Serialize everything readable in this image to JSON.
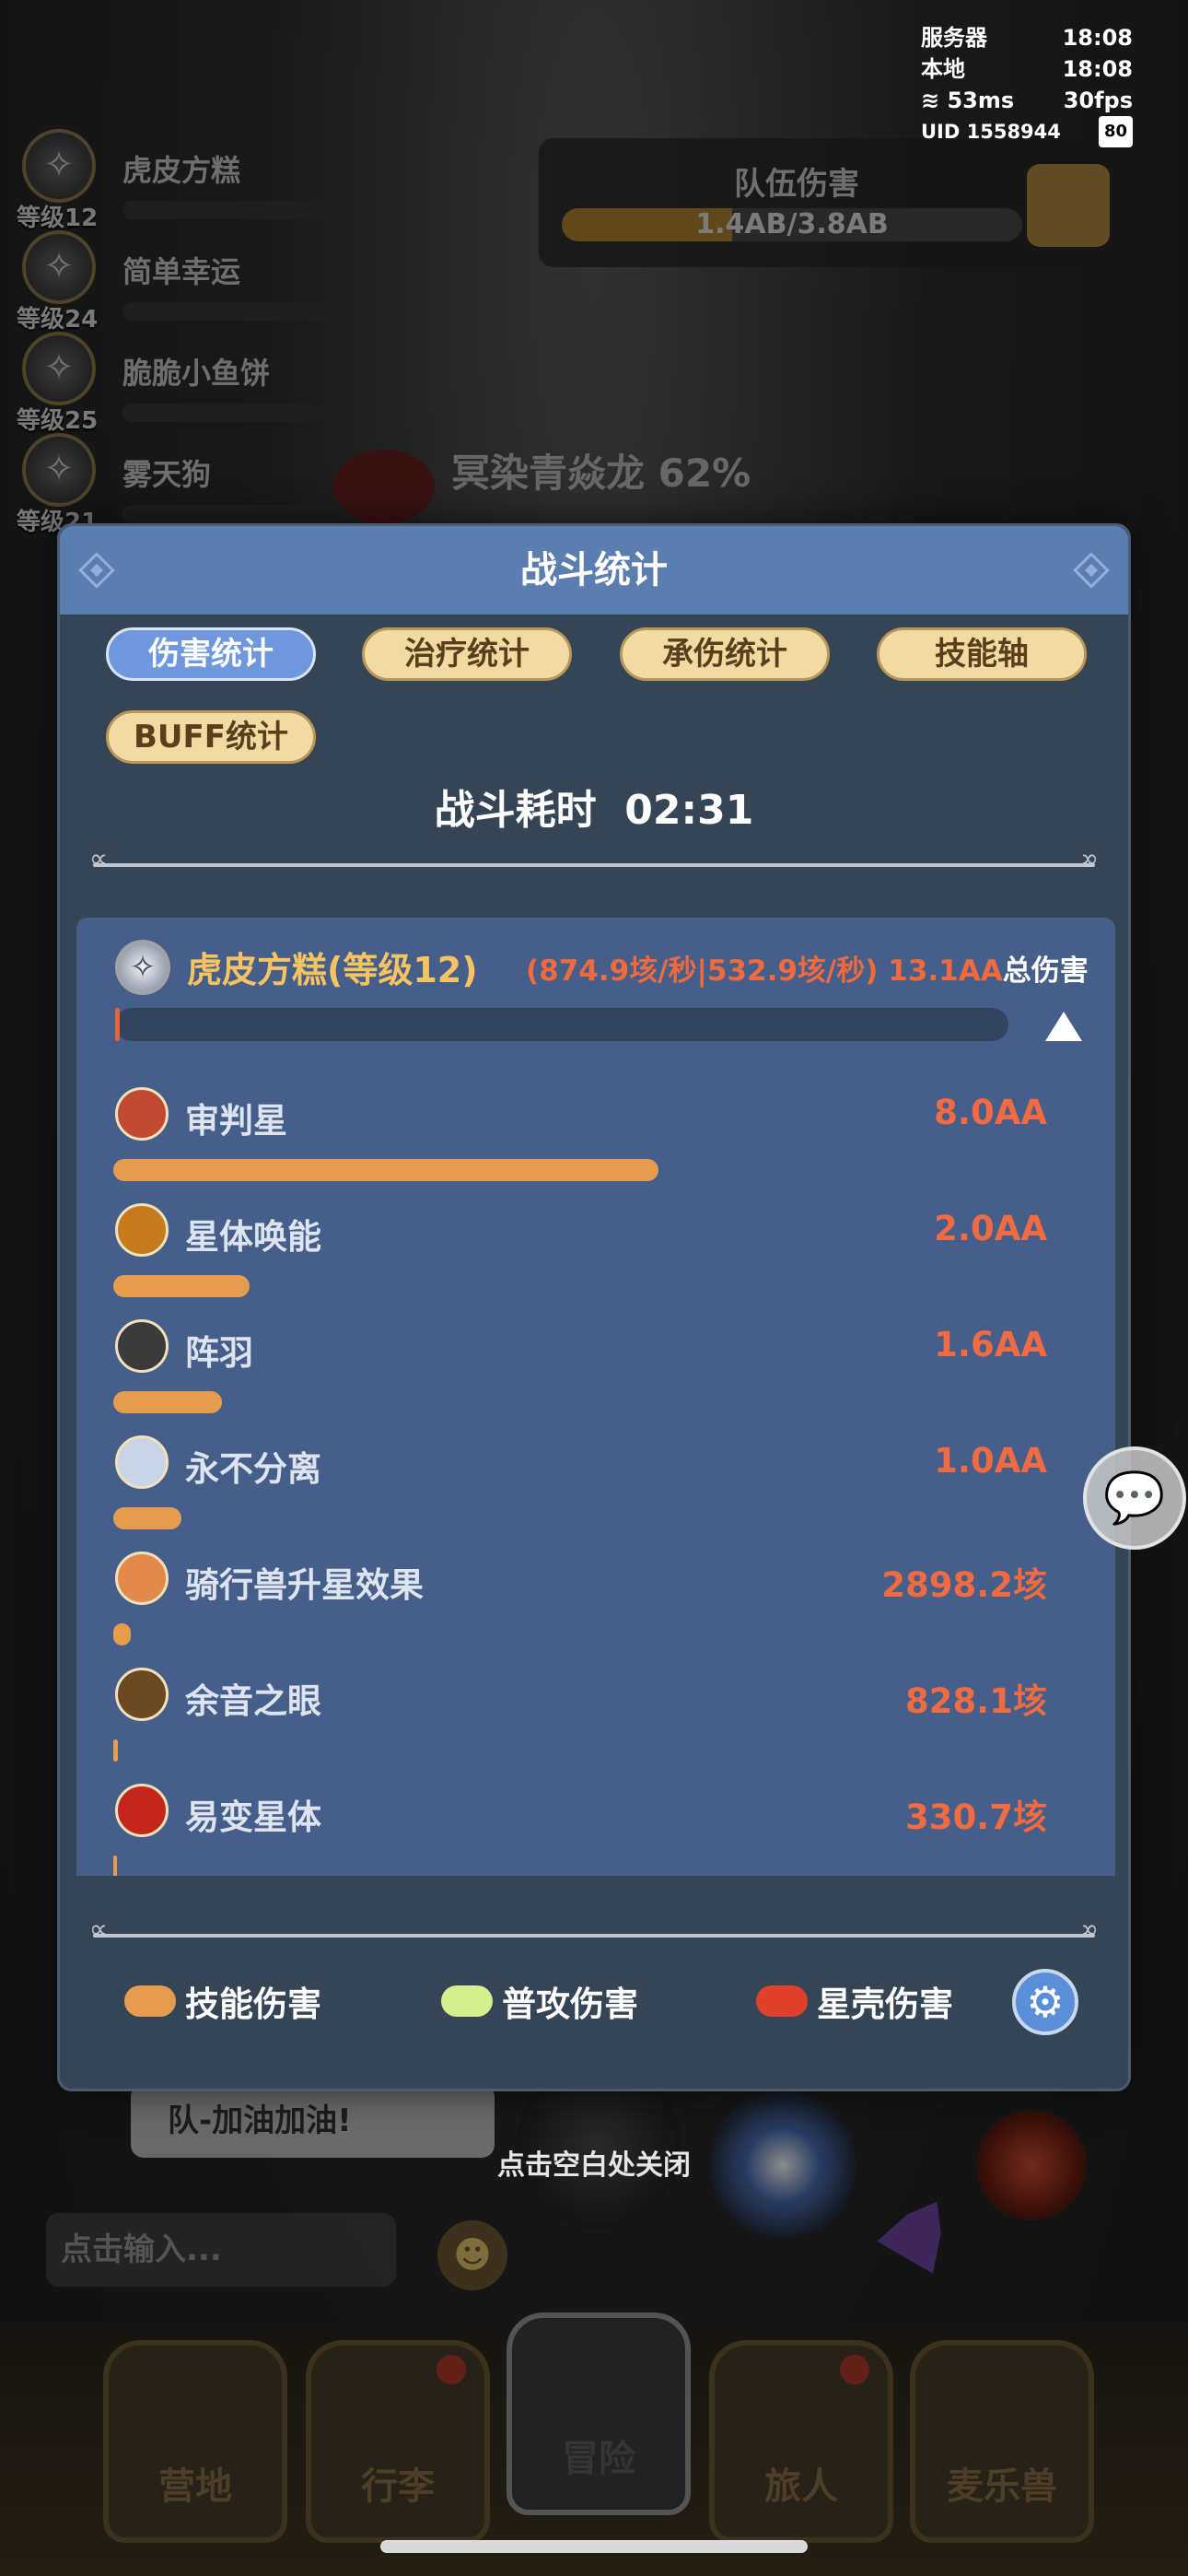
{
  "status": {
    "server_label": "服务器",
    "server_time": "18:08",
    "local_label": "本地",
    "local_time": "18:08",
    "ping": "53ms",
    "fps": "30fps",
    "uid": "UID 1558944",
    "battery": "80"
  },
  "background": {
    "players": [
      {
        "name": "虎皮方糕",
        "level": "等级12"
      },
      {
        "name": "简单幸运",
        "level": "等级24"
      },
      {
        "name": "脆脆小鱼饼",
        "level": "等级25"
      },
      {
        "name": "雾天狗",
        "level": "等级21"
      }
    ],
    "team_damage": {
      "title": "队伍伤害",
      "value": "1.4AB/3.8AB",
      "fill_fraction": 0.37
    },
    "boss": "冥染青焱龙 62%",
    "chat_bubble": "队-加油加油!",
    "close_hint": "点击空白处关闭",
    "chat_placeholder": "点击输入...",
    "nav": [
      {
        "label": "营地",
        "icon": "castle-icon",
        "badge": false
      },
      {
        "label": "行李",
        "icon": "backpack-icon",
        "badge": true
      },
      {
        "label": "冒险",
        "icon": "crossed-swords-icon",
        "badge": false,
        "active": true
      },
      {
        "label": "旅人",
        "icon": "traveler-icon",
        "badge": true
      },
      {
        "label": "麦乐兽",
        "icon": "fox-icon",
        "badge": false
      }
    ]
  },
  "modal": {
    "title": "战斗统计",
    "tabs": [
      {
        "label": "伤害统计",
        "active": true
      },
      {
        "label": "治疗统计",
        "active": false
      },
      {
        "label": "承伤统计",
        "active": false
      },
      {
        "label": "技能轴",
        "active": false
      },
      {
        "label": "BUFF统计",
        "active": false
      }
    ],
    "duration_label": "战斗耗时",
    "duration_value": "02:31",
    "player": {
      "name": "虎皮方糕(等级12)",
      "rates": "(874.9垓/秒|532.9垓/秒)",
      "total": "13.1AA",
      "total_label": "总伤害",
      "bar_fill_fraction": 0.005
    },
    "skills": [
      {
        "name": "审判星",
        "value": "8.0AA",
        "fraction": 0.61,
        "icon": "judgment-star-icon",
        "color": "#c24a33"
      },
      {
        "name": "星体唤能",
        "value": "2.0AA",
        "fraction": 0.153,
        "icon": "star-burst-icon",
        "color": "#c57a1e"
      },
      {
        "name": "阵羽",
        "value": "1.6AA",
        "fraction": 0.122,
        "icon": "feather-icon",
        "color": "#3b3b3b"
      },
      {
        "name": "永不分离",
        "value": "1.0AA",
        "fraction": 0.076,
        "icon": "snowflake-icon",
        "color": "#c9d5e6"
      },
      {
        "name": "骑行兽升星效果",
        "value": "2898.2垓",
        "fraction": 0.02,
        "icon": "mount-icon",
        "color": "#e28a4b"
      },
      {
        "name": "余音之眼",
        "value": "828.1垓",
        "fraction": 0.005,
        "icon": "eye-icon",
        "color": "#6b4a23"
      },
      {
        "name": "易变星体",
        "value": "330.7垓",
        "fraction": 0.003,
        "icon": "yin-yang-icon",
        "color": "#c4261e"
      }
    ],
    "legend": [
      {
        "label": "技能伤害",
        "color": "#e59c4f"
      },
      {
        "label": "普攻伤害",
        "color": "#d5ee8f"
      },
      {
        "label": "星壳伤害",
        "color": "#e0402c"
      }
    ]
  }
}
